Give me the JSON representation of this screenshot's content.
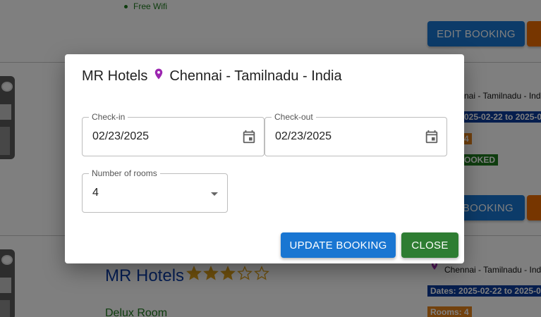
{
  "background": {
    "amenity": "Free Wifi",
    "edit_booking_label": "EDIT BOOKING",
    "card1": {
      "location_partial": "nai - Tamilnadu - India",
      "dates_partial": "025-02-22 to 2025-0",
      "rooms_partial": "4",
      "status_partial": "OOKED",
      "edit_partial": "BOOKING"
    },
    "card2": {
      "hotel_name": "MR Hotels",
      "rating": 3,
      "rating_max": 5,
      "room_name": "Delux Room",
      "location": "Chennai - Tamilnadu - Ind",
      "dates": "Dates: 2025-02-22 to 2025-0",
      "rooms": "Rooms: 4"
    }
  },
  "dialog": {
    "hotel_name": "MR Hotels",
    "location": "Chennai - Tamilnadu - India",
    "checkin_label": "Check-in",
    "checkin_value": "02/23/2025",
    "checkout_label": "Check-out",
    "checkout_value": "02/23/2025",
    "rooms_label": "Number of rooms",
    "rooms_value": "4",
    "update_label": "UPDATE BOOKING",
    "close_label": "CLOSE"
  },
  "colors": {
    "primary": "#1976d2",
    "success": "#2e7d32",
    "pin": "#9c27b0",
    "star": "#e0a21b",
    "hotel_title": "#0b3ca8"
  }
}
